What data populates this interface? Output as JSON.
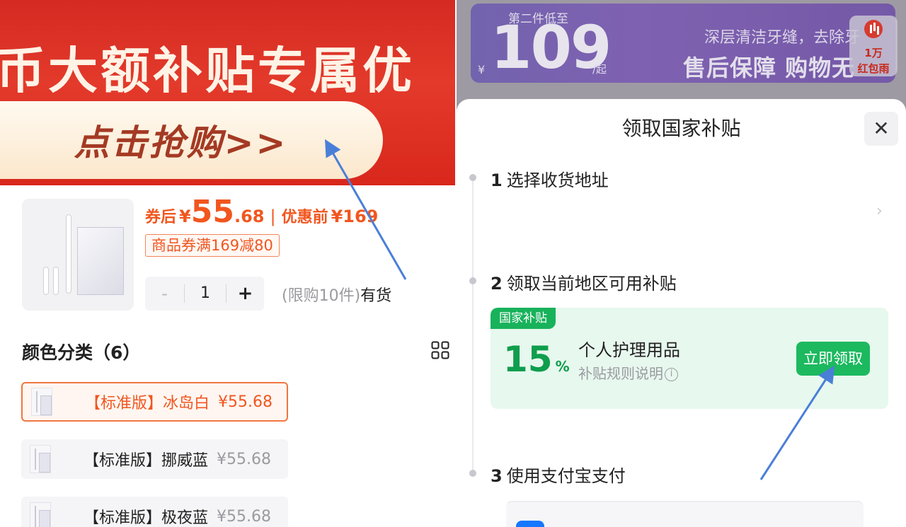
{
  "left": {
    "banner": {
      "slogan": "币大额补贴专属优",
      "cta": "点击抢购>>"
    },
    "product": {
      "price_label": "券后",
      "price_yen": "¥",
      "price_int": "55",
      "price_dec": ".68",
      "separator": "|",
      "orig_label": "优惠前",
      "orig_price": "¥169",
      "coupon": "商品券满169减80",
      "quantity": {
        "minus": "-",
        "value": "1",
        "plus": "+"
      },
      "limit_note": "(限购10件)",
      "stock_note": "有货"
    },
    "colors": {
      "title": "颜色分类（6）",
      "variants": [
        {
          "name": "【标准版】冰岛白",
          "price": "¥55.68",
          "selected": true
        },
        {
          "name": "【标准版】挪威蓝",
          "price": "¥55.68",
          "selected": false
        },
        {
          "name": "【标准版】极夜蓝",
          "price": "¥55.68",
          "selected": false
        }
      ]
    }
  },
  "right": {
    "promo": {
      "subtitle": "第二件低至",
      "yen": "¥",
      "number": "109",
      "unit": "/起",
      "desc": "深层清洁牙缝，去除牙",
      "tagline": "售后保障 购物无"
    },
    "hongbao": {
      "count": "1万",
      "label": "红包雨"
    },
    "sheet": {
      "title": "领取国家补贴",
      "close": "✕",
      "steps": [
        {
          "num": "1",
          "label": "选择收货地址"
        },
        {
          "num": "2",
          "label": "领取当前地区可用补贴"
        },
        {
          "num": "3",
          "label": "使用支付宝支付"
        }
      ],
      "address_chevron": "›",
      "subsidy": {
        "badge": "国家补贴",
        "percent": "15",
        "percent_unit": "%",
        "category": "个人护理用品",
        "rule": "补贴规则说明",
        "info": "i",
        "claim": "立即领取"
      }
    }
  },
  "colors": {
    "banner_red": "#d9271c",
    "price_orange": "#f1561f",
    "subsidy_green": "#18b25b",
    "promo_purple": "#6b5ab0",
    "arrow_blue": "#4a7fd8"
  }
}
